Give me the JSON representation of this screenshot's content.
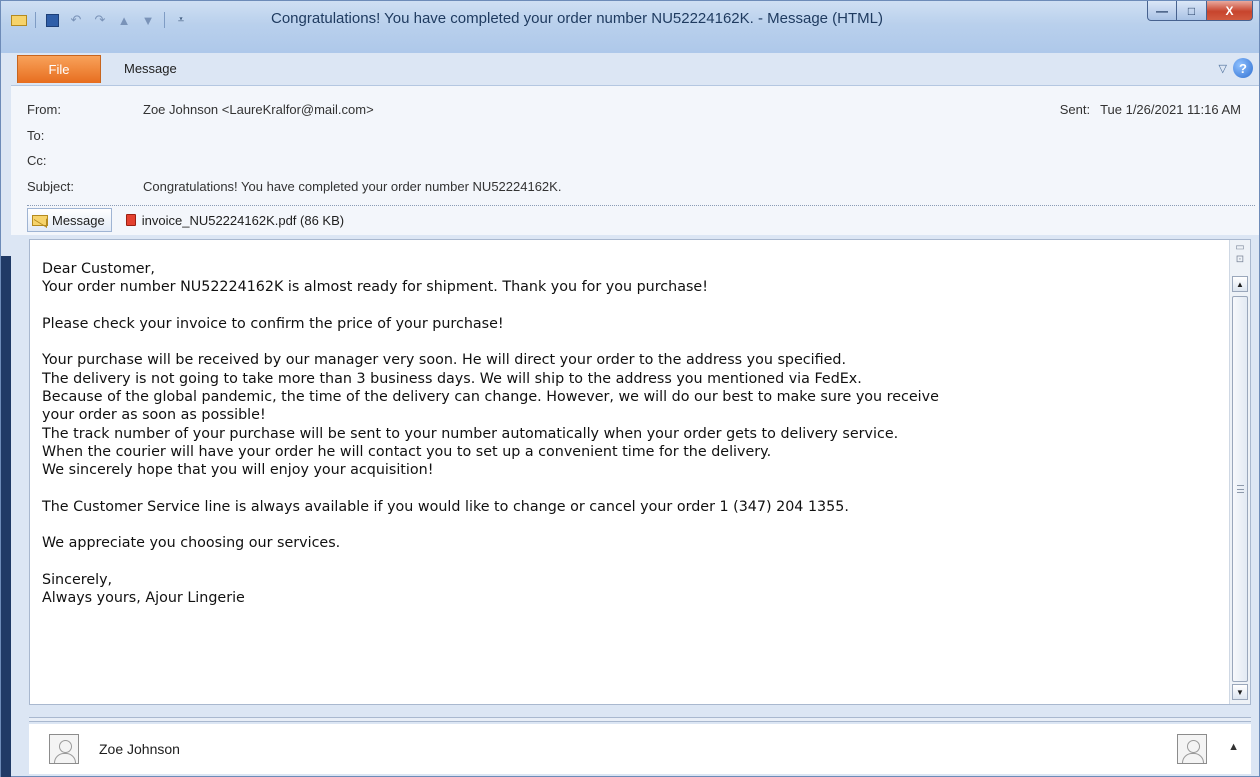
{
  "window": {
    "title": "Congratulations! You have completed your order number NU52224162K. - Message (HTML)",
    "controls": {
      "minimize": "—",
      "maximize": "□",
      "close": "X"
    }
  },
  "ribbon": {
    "tabs": [
      {
        "label": "File"
      },
      {
        "label": "Message"
      }
    ]
  },
  "header": {
    "from_label": "From:",
    "from_value": "Zoe Johnson <LaureKralfor@mail.com>",
    "to_label": "To:",
    "cc_label": "Cc:",
    "subject_label": "Subject:",
    "subject_value": "Congratulations! You have completed your order number NU52224162K.",
    "sent_label": "Sent:",
    "sent_value": "Tue 1/26/2021 11:16 AM"
  },
  "attachments": {
    "message_tab": "Message",
    "file": "invoice_NU52224162K.pdf (86 KB)"
  },
  "body": {
    "text": "Dear Customer,\nYour order number NU52224162K is almost ready for shipment. Thank you for you purchase!\n\nPlease check your invoice to confirm the price of your purchase!\n\nYour purchase will be received by our manager very soon. He will direct your order to the address you specified.\nThe delivery is not going to take more than 3 business days. We will ship to the address you mentioned via FedEx.\nBecause of the global pandemic, the time of the delivery can change. However, we will do our best to make sure you receive\nyour order as soon as possible!\nThe track number of your purchase will be sent to your number automatically when your order gets to delivery service.\nWhen the courier will have your order he will contact you to set up a convenient time for the delivery.\nWe sincerely hope that you will enjoy your acquisition!\n\nThe Customer Service line is always available if you would like to change or cancel your order 1 (347) 204 1355.\n\nWe appreciate you choosing our services.\n\nSincerely,\nAlways yours, Ajour Lingerie"
  },
  "people_pane": {
    "name": "Zoe Johnson"
  },
  "icons": {
    "envelope": "envelope-icon",
    "save": "save-icon",
    "undo": "undo-icon",
    "redo": "redo-icon",
    "up": "up-arrow-icon",
    "down": "down-arrow-icon",
    "help": "help-icon",
    "pdf": "pdf-icon",
    "avatar": "avatar-icon"
  },
  "colors": {
    "file_tab": "#e76d1f",
    "titlebar": "#b9d0ec",
    "close_button": "#c7442d"
  }
}
